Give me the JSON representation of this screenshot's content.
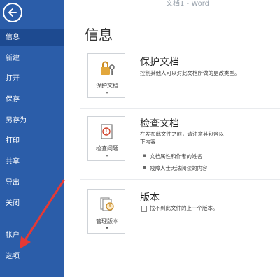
{
  "window": {
    "title": "文档1 - Word"
  },
  "sidebar": {
    "items": [
      {
        "label": "信息"
      },
      {
        "label": "新建"
      },
      {
        "label": "打开"
      },
      {
        "label": "保存"
      },
      {
        "label": "另存为"
      },
      {
        "label": "打印"
      },
      {
        "label": "共享"
      },
      {
        "label": "导出"
      },
      {
        "label": "关闭"
      },
      {
        "label": "帐户"
      },
      {
        "label": "选项"
      }
    ]
  },
  "main": {
    "title": "信息",
    "sections": [
      {
        "button_label": "保护文档",
        "title": "保护文档",
        "description": "控制其他人可以对此文档所做的更改类型。",
        "bullets": []
      },
      {
        "button_label": "检查问题",
        "title": "检查文档",
        "description_line1": "在发布此文件之前，请注意其包含以",
        "description_line2": "下内容:",
        "bullets": [
          "文档属性和作者的姓名",
          "残障人士无法阅读的内容"
        ]
      },
      {
        "button_label": "管理版本",
        "title": "版本",
        "description": "找不到此文件的上一个版本。",
        "bullets": []
      }
    ]
  },
  "colors": {
    "sidebar": "#2b5da9",
    "arrow": "#e53935"
  }
}
